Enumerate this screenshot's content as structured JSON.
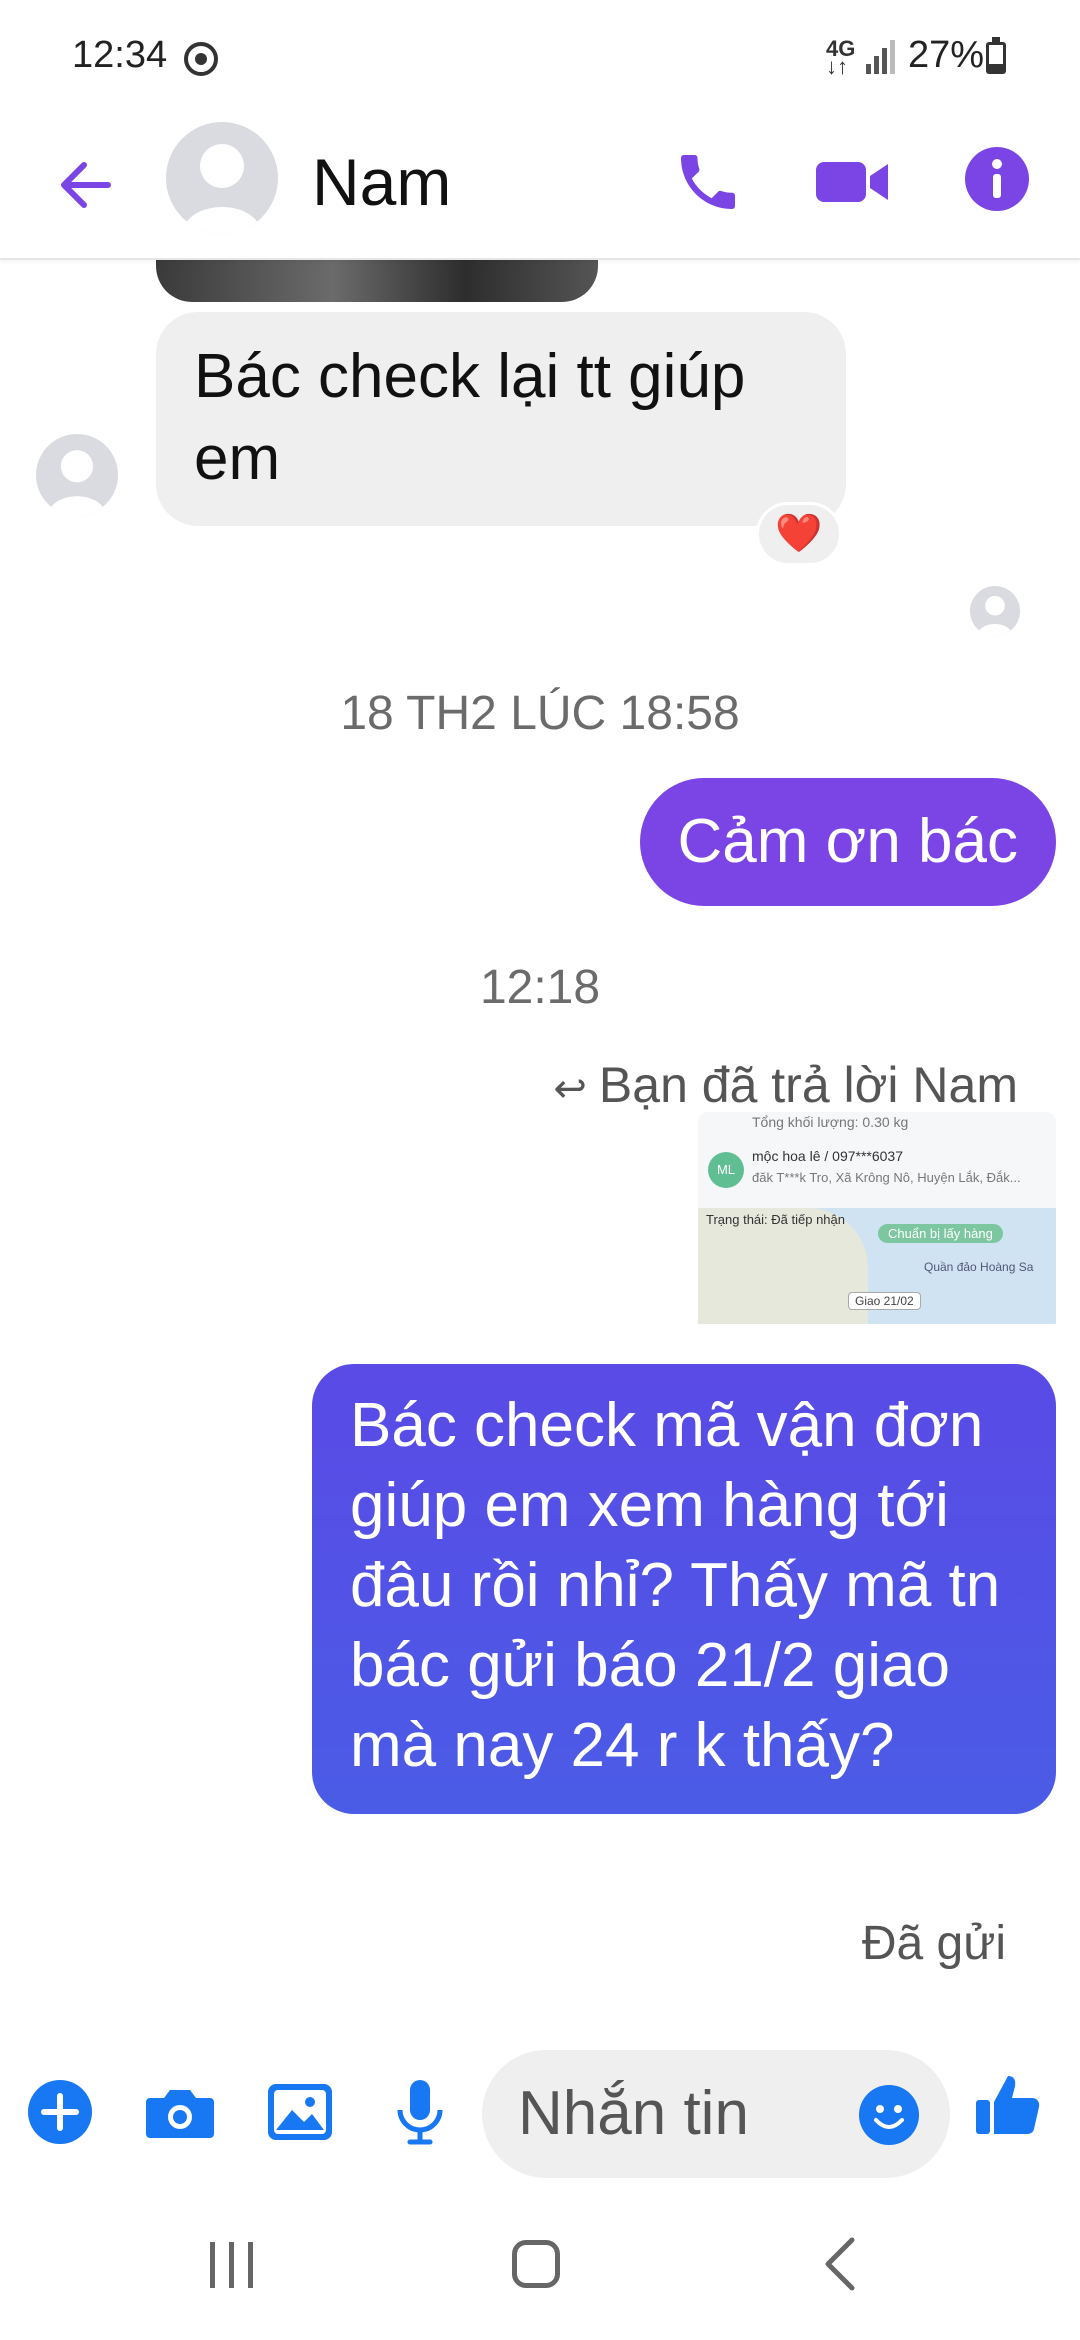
{
  "status_bar": {
    "time": "12:34",
    "network": "4G",
    "battery": "27%",
    "battery_level": 0.27
  },
  "header": {
    "contact_name": "Nam",
    "back_icon": "arrow-left-icon",
    "call_icon": "phone-icon",
    "video_icon": "video-camera-icon",
    "info_icon": "info-icon",
    "accent_color": "#7b45e6"
  },
  "messages": {
    "incoming_1": {
      "text": "Bác check lại tt giúp em",
      "reaction": "❤️"
    },
    "divider_1": "18 TH2 LÚC 18:58",
    "outgoing_1": {
      "text": "Cảm ơn bác"
    },
    "divider_2": "12:18",
    "reply_label": "Bạn đã trả lời Nam",
    "quoted_image": {
      "weight": "Tổng khối lượng: 0.30 kg",
      "avatar_initials": "ML",
      "sender": "mộc hoa lê / 097***6037",
      "address": "đăk T***k Tro, Xã Krông Nô, Huyện Lắk, Đắk...",
      "status": "Trạng thái: Đã tiếp nhận",
      "chip": "Chuẩn bị lấy hàng",
      "islands": "Quần đảo Hoàng Sa",
      "delivery": "Giao 21/02"
    },
    "outgoing_2": {
      "text": "Bác check mã vận đơn giúp em xem hàng tới đâu rồi nhỉ? Thấy mã tn bác gửi báo 21/2 giao mà nay 24 r k thấy?"
    },
    "sent_status": "Đã gửi"
  },
  "composer": {
    "placeholder": "Nhắn tin",
    "icons": [
      "plus-icon",
      "camera-icon",
      "image-icon",
      "microphone-icon",
      "emoji-icon",
      "thumbs-up-icon"
    ],
    "icon_color": "#1877f2"
  },
  "nav": {
    "recent": "recent-apps-icon",
    "home": "home-icon",
    "back": "back-icon"
  }
}
